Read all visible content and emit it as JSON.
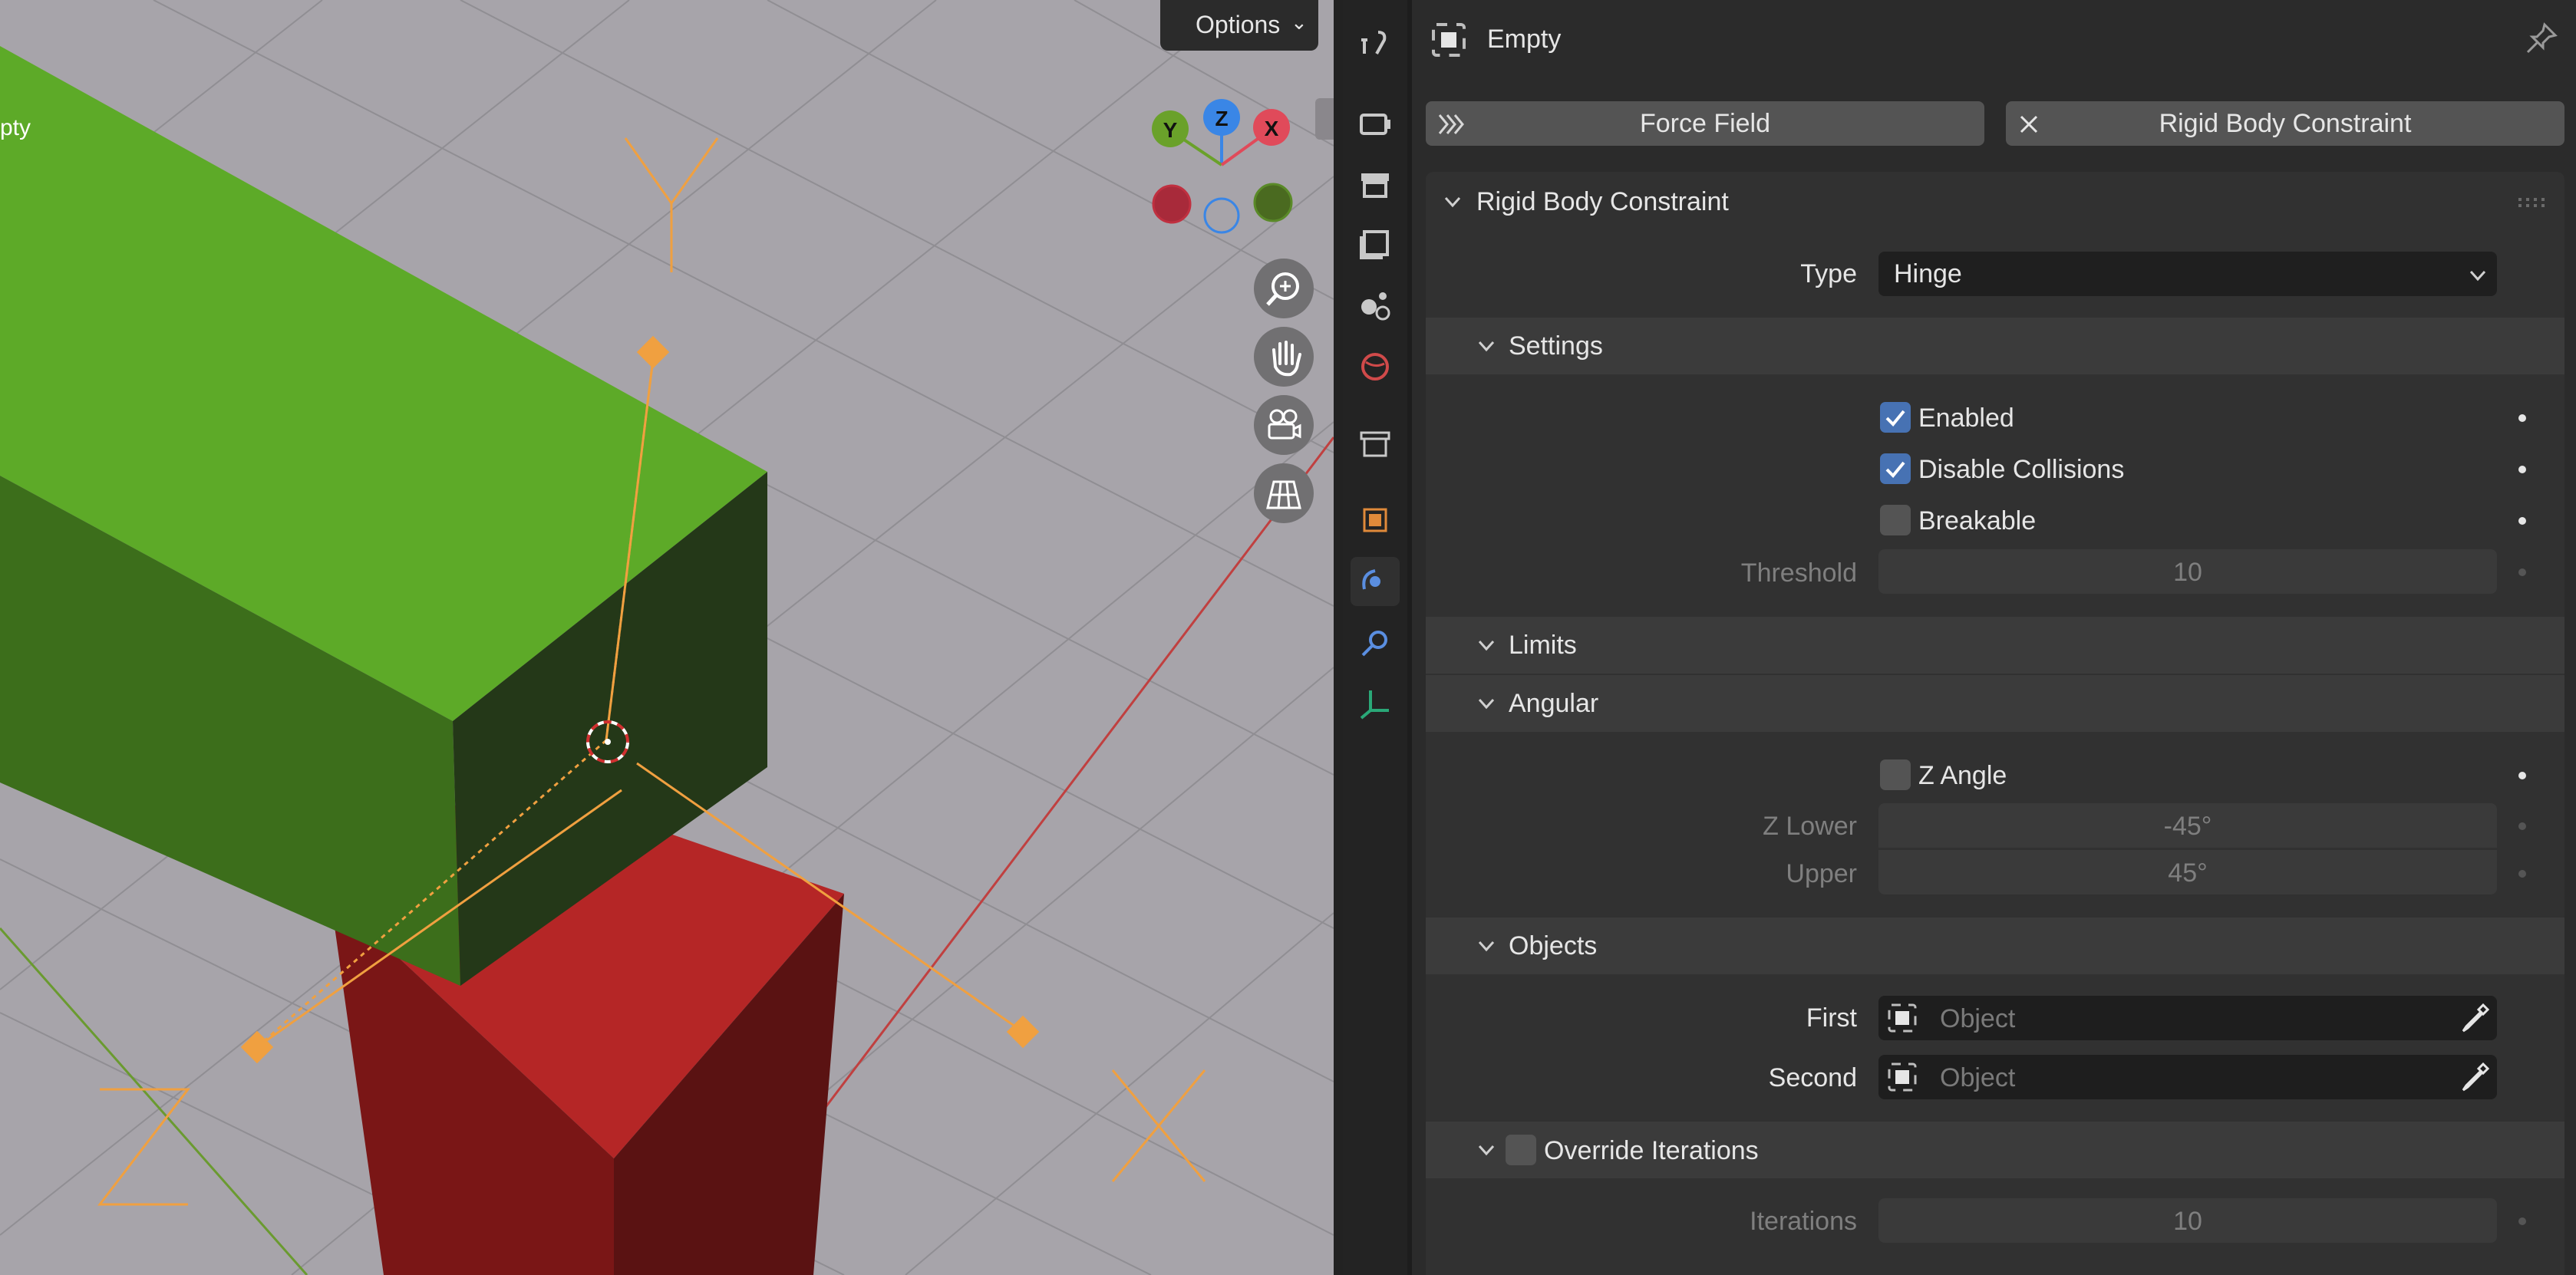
{
  "viewport": {
    "object_label": "pty",
    "options_label": "Options",
    "gizmo_axes": [
      "Y",
      "Z",
      "X"
    ],
    "colors": {
      "floor": "#a7a4aa",
      "green_box": "#5daa28",
      "red_box": "#b52626",
      "empty_orange": "#f0a040"
    }
  },
  "sidebar_tabs": [
    "tool-icon",
    "render-icon",
    "output-icon",
    "view-layer-icon",
    "scene-icon",
    "world-icon",
    "collection-icon",
    "object-icon",
    "physics-icon",
    "constraint-icon",
    "data-icon"
  ],
  "properties": {
    "object_name": "Empty",
    "buttons": {
      "force_field": "Force Field",
      "rigid_body_constraint": "Rigid Body Constraint"
    },
    "panel_title": "Rigid Body Constraint",
    "type": {
      "label": "Type",
      "value": "Hinge"
    },
    "settings": {
      "title": "Settings",
      "enabled": {
        "label": "Enabled",
        "checked": true
      },
      "disable_collisions": {
        "label": "Disable Collisions",
        "checked": true
      },
      "breakable": {
        "label": "Breakable",
        "checked": false
      },
      "threshold": {
        "label": "Threshold",
        "value": "10"
      }
    },
    "limits": {
      "title": "Limits",
      "angular": {
        "title": "Angular",
        "z_angle": {
          "label": "Z Angle",
          "checked": false
        },
        "z_lower": {
          "label": "Z Lower",
          "value": "-45°"
        },
        "upper": {
          "label": "Upper",
          "value": "45°"
        }
      }
    },
    "objects": {
      "title": "Objects",
      "first": {
        "label": "First",
        "placeholder": "Object"
      },
      "second": {
        "label": "Second",
        "placeholder": "Object"
      }
    },
    "override_iterations": {
      "title": "Override Iterations",
      "checked": false,
      "iterations": {
        "label": "Iterations",
        "value": "10"
      }
    }
  }
}
